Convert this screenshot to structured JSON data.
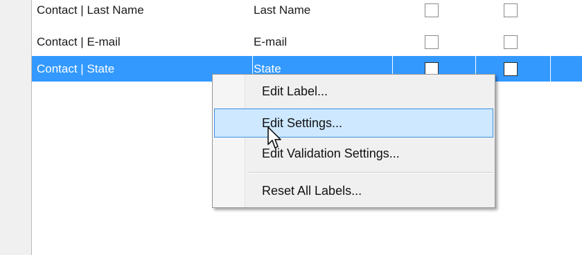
{
  "rows": [
    {
      "field": "Contact | Last Name",
      "label": "Last Name",
      "col1_checked": false,
      "col2_checked": false
    },
    {
      "field": "Contact | E-mail",
      "label": "E-mail",
      "col1_checked": false,
      "col2_checked": false
    },
    {
      "field": "Contact | State",
      "label": "State",
      "col1_checked": false,
      "col2_checked": false,
      "selected": true
    }
  ],
  "context_menu": {
    "items": [
      {
        "label": "Edit Label..."
      },
      {
        "label": "Edit Settings...",
        "hovered": true
      },
      {
        "label": "Edit Validation Settings..."
      },
      {
        "label": "Reset All Labels..."
      }
    ]
  },
  "colors": {
    "selection": "#3399ff",
    "menu_hover": "#cde8ff",
    "menu_hover_border": "#3d8ee0"
  },
  "icons": {
    "cursor": "arrow-cursor-icon"
  }
}
